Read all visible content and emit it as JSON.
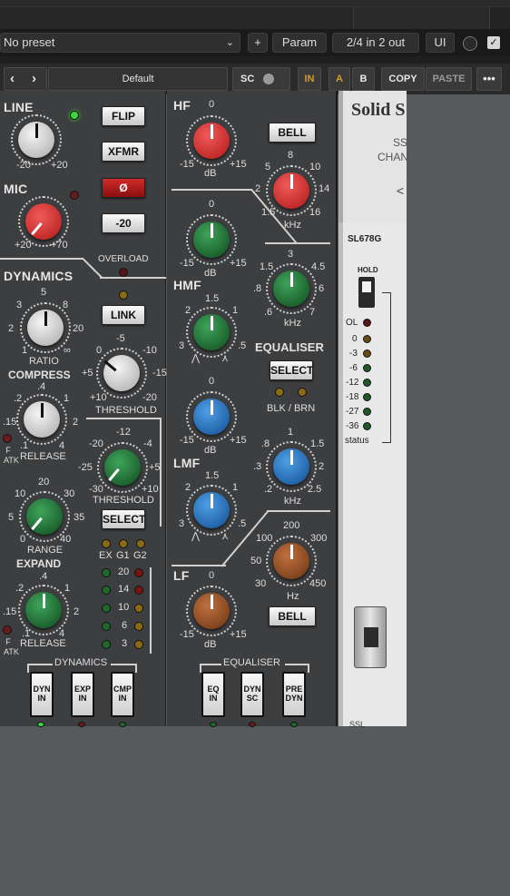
{
  "host": {
    "preset": "No preset",
    "plus": "+",
    "param": "Param",
    "routing": "2/4 in 2 out",
    "ui": "UI"
  },
  "plugin_bar": {
    "preset": "Default",
    "sc": "SC",
    "in": "IN",
    "a": "A",
    "b": "B",
    "copy": "COPY",
    "paste": "PASTE",
    "more": "•••"
  },
  "left": {
    "line": "LINE",
    "mic": "MIC",
    "flip": "FLIP",
    "xfmr": "XFMR",
    "phase": "Ø",
    "pad": "-20",
    "overload": "OVERLOAD",
    "link": "LINK",
    "dynamics": "DYNAMICS",
    "line_min": "-20",
    "line_max": "+20",
    "mic_min": "+20",
    "mic_max": "+70",
    "ratio": "RATIO",
    "ratio_ticks": [
      "5",
      "3",
      "8",
      "2",
      "20",
      "1",
      "∞"
    ],
    "compress": "COMPRESS",
    "threshold": "THRESHOLD",
    "comp_thr_ticks": [
      "-5",
      "0",
      "-10",
      "+5",
      "-15",
      "+10",
      "-20"
    ],
    "release": "RELEASE",
    "rel_ticks": [
      ".4",
      ".2",
      "1",
      ".15",
      "2",
      ".1",
      "4"
    ],
    "fatk": "F ATK",
    "gate_thr_ticks": [
      "-12",
      "-20",
      "-4",
      "-25",
      "+5",
      "-30",
      "+10"
    ],
    "range": "RANGE",
    "range_ticks": [
      "20",
      "10",
      "30",
      "5",
      "35",
      "0",
      "40"
    ],
    "select": "SELECT",
    "expand": "EXPAND",
    "ex": "EX",
    "g1": "G1",
    "g2": "G2",
    "meter": [
      "20",
      "14",
      "10",
      "6",
      "3"
    ],
    "exp_rel_ticks": [
      ".4",
      ".2",
      "1",
      ".15",
      "2",
      ".1",
      "4"
    ],
    "dyn_group": "DYNAMICS",
    "dyn_in": "DYN IN",
    "exp_in": "EXP IN",
    "cmp_in": "CMP IN"
  },
  "eq": {
    "hf": "HF",
    "hmf": "HMF",
    "lmf": "LMF",
    "lf": "LF",
    "bell": "BELL",
    "equaliser": "EQUALISER",
    "select": "SELECT",
    "blkbrn": "BLK / BRN",
    "db": "dB",
    "khz": "kHz",
    "hz": "Hz",
    "gain_ticks": [
      "0",
      "-15",
      "+15"
    ],
    "hf_freq_ticks": [
      "8",
      "5",
      "10",
      "2",
      "14",
      "1.5",
      "16"
    ],
    "hmf_freq_ticks": [
      "3",
      "1.5",
      "4.5",
      ".8",
      "6",
      ".6",
      "7"
    ],
    "q_ticks": [
      "1.5",
      "2",
      "1",
      "3",
      ".5"
    ],
    "lmf_freq_ticks": [
      "1",
      ".8",
      "1.5",
      ".3",
      "2",
      ".2",
      "2.5"
    ],
    "lf_freq_ticks": [
      "200",
      "100",
      "300",
      "50",
      "30",
      "450"
    ],
    "eq_group": "EQUALISER",
    "eq_in": "EQ IN",
    "dyn_sc": "DYN SC",
    "pre_dyn": "PRE DYN"
  },
  "right": {
    "brand": "Solid S",
    "ss": "SS",
    "chan": "CHAN",
    "model": "SL678G",
    "hold": "HOLD",
    "meter_labels": [
      "OL",
      "0",
      "-3",
      "-6",
      "-12",
      "-18",
      "-27",
      "-36"
    ],
    "status": "status",
    "ssl": "SSL"
  },
  "colors": {
    "red": "#c0232b",
    "green": "#1c6b2e",
    "blue": "#1f5fa8",
    "brown": "#8a4a24",
    "grey": "#cfcfcf"
  }
}
